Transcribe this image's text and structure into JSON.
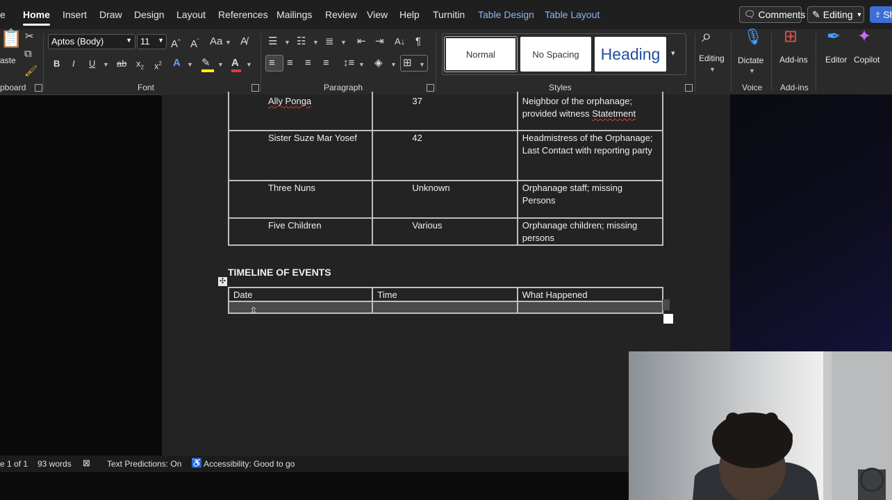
{
  "tabs": [
    {
      "label": "e",
      "state": "normal"
    },
    {
      "label": "Home",
      "state": "active"
    },
    {
      "label": "Insert",
      "state": "normal"
    },
    {
      "label": "Draw",
      "state": "normal"
    },
    {
      "label": "Design",
      "state": "normal"
    },
    {
      "label": "Layout",
      "state": "normal"
    },
    {
      "label": "References",
      "state": "normal"
    },
    {
      "label": "Mailings",
      "state": "normal"
    },
    {
      "label": "Review",
      "state": "normal"
    },
    {
      "label": "View",
      "state": "normal"
    },
    {
      "label": "Help",
      "state": "normal"
    },
    {
      "label": "Turnitin",
      "state": "normal"
    },
    {
      "label": "Table Design",
      "state": "contextual"
    },
    {
      "label": "Table Layout",
      "state": "contextual"
    }
  ],
  "topbar": {
    "comments_label": "Comments",
    "editing_label": "Editing",
    "share_label": "Sh"
  },
  "ribbon": {
    "clipboard": {
      "paste_label": "aste",
      "group_label": "pboard"
    },
    "font": {
      "font_name": "Aptos (Body)",
      "font_size": "11",
      "group_label": "Font"
    },
    "paragraph": {
      "group_label": "Paragraph"
    },
    "styles": {
      "normal": "Normal",
      "no_spacing": "No Spacing",
      "heading": "Heading",
      "group_label": "Styles"
    },
    "editing": {
      "label": "Editing"
    },
    "voice": {
      "dictate_label": "Dictate",
      "group_label": "Voice"
    },
    "addins": {
      "label": "Add-ins",
      "group_label": "Add-ins"
    },
    "editor": {
      "label": "Editor"
    },
    "copilot": {
      "label": "Copilot"
    }
  },
  "persons_table": {
    "rows": [
      {
        "name": "Ally Ponga",
        "age": "37",
        "role_parts": [
          "Neighbor of the orphanage; provided witness ",
          "Statetment"
        ]
      },
      {
        "name": "Sister Suze Mar Yosef",
        "age": "42",
        "role_parts": [
          "Headmistress of the Orphanage; Last Contact with reporting party",
          ""
        ]
      },
      {
        "name": "Three Nuns",
        "age": "Unknown",
        "role_parts": [
          "Orphanage staff; missing Persons",
          ""
        ]
      },
      {
        "name": "Five Children",
        "age": "Various",
        "role_parts": [
          "Orphanage children; missing persons",
          ""
        ]
      }
    ]
  },
  "timeline": {
    "heading": "TIMELINE OF EVENTS",
    "headers": [
      "Date",
      "Time",
      "What Happened"
    ]
  },
  "status": {
    "page": "e 1 of 1",
    "words": "93 words",
    "predictions": "Text Predictions: On",
    "accessibility": "Accessibility: Good to go"
  },
  "colors": {
    "ribbon": "#2a2a2a",
    "tabbar": "#1f1f1f",
    "document": "#232323",
    "contextual_tab": "#8ab4f8",
    "table_border": "#bfbfbf"
  },
  "icons": [
    "paste-icon",
    "cut-icon",
    "copy-icon",
    "format-painter-icon",
    "grow-font-icon",
    "shrink-font-icon",
    "change-case-icon",
    "clear-formatting-icon",
    "bold-icon",
    "italic-icon",
    "underline-icon",
    "strikethrough-icon",
    "subscript-icon",
    "superscript-icon",
    "text-effects-icon",
    "highlight-icon",
    "font-color-icon",
    "bullets-icon",
    "numbering-icon",
    "multilevel-list-icon",
    "decrease-indent-icon",
    "increase-indent-icon",
    "sort-icon",
    "show-marks-icon",
    "align-left-icon",
    "center-icon",
    "align-right-icon",
    "justify-icon",
    "line-spacing-icon",
    "shading-icon",
    "borders-icon",
    "search-icon",
    "microphone-icon",
    "addins-grid-icon",
    "editor-pen-icon",
    "copilot-icon",
    "table-move-handle-icon",
    "resize-cursor-icon",
    "table-resize-handle-icon"
  ]
}
